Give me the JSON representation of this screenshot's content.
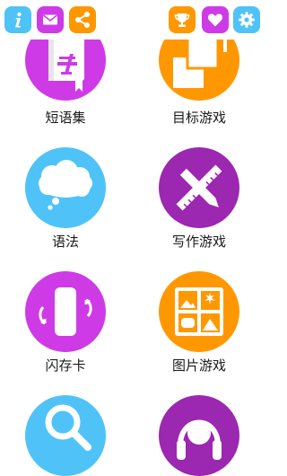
{
  "toolbar": {
    "colors": {
      "info": "#4FC3F7",
      "mail": "#CE3BE6",
      "share": "#FF9800",
      "trophy": "#FF9800",
      "heart": "#CE3BE6",
      "settings": "#4FC3F7"
    },
    "icons": [
      "info-icon",
      "mail-icon",
      "share-icon",
      "trophy-icon",
      "heart-icon",
      "gear-icon"
    ]
  },
  "tiles": [
    {
      "label": "短语集",
      "color": "#CE3BE6",
      "icon": "phrasebook-icon"
    },
    {
      "label": "目标游戏",
      "color": "#FF9800",
      "icon": "target-game-icon"
    },
    {
      "label": "语法",
      "color": "#4FC3F7",
      "icon": "speech-cloud-icon"
    },
    {
      "label": "写作游戏",
      "color": "#9C27B0",
      "icon": "writing-game-icon"
    },
    {
      "label": "闪存卡",
      "color": "#CE3BE6",
      "icon": "flashcard-icon"
    },
    {
      "label": "图片游戏",
      "color": "#FF9800",
      "icon": "picture-game-icon"
    },
    {
      "label": "",
      "color": "#4FC3F7",
      "icon": "search-icon"
    },
    {
      "label": "",
      "color": "#9C27B0",
      "icon": "headphones-icon"
    }
  ]
}
